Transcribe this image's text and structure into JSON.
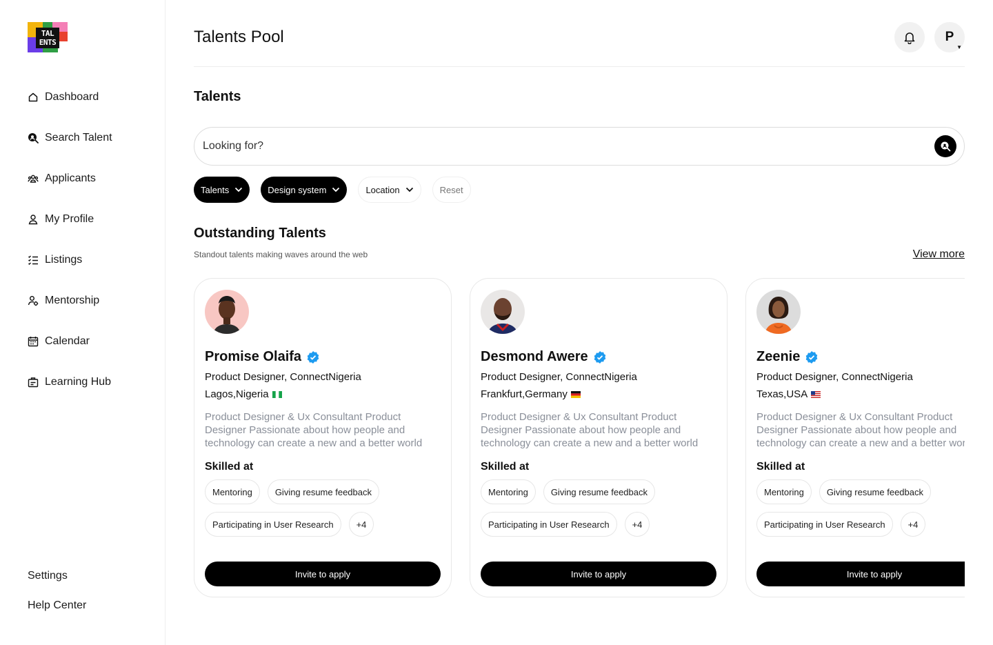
{
  "logo": {
    "text_line1": "TAL",
    "text_line2": "ENTS"
  },
  "sidebar": {
    "items": [
      {
        "label": "Dashboard",
        "icon": "home-icon"
      },
      {
        "label": "Search Talent",
        "icon": "search-talent-icon"
      },
      {
        "label": "Applicants",
        "icon": "applicants-icon"
      },
      {
        "label": "My Profile",
        "icon": "profile-icon"
      },
      {
        "label": "Listings",
        "icon": "listings-icon"
      },
      {
        "label": "Mentorship",
        "icon": "mentorship-icon"
      },
      {
        "label": "Calendar",
        "icon": "calendar-icon"
      },
      {
        "label": "Learning Hub",
        "icon": "learning-hub-icon"
      }
    ],
    "bottom": {
      "settings": "Settings",
      "help": "Help Center"
    }
  },
  "header": {
    "title": "Talents Pool",
    "avatar_initial": "P"
  },
  "main": {
    "section_title": "Talents",
    "search": {
      "placeholder": "Looking for?"
    },
    "filters": {
      "talents": "Talents",
      "design_system": "Design system",
      "location": "Location",
      "reset": "Reset"
    },
    "outstanding": {
      "title": "Outstanding Talents",
      "subtitle": "Standout talents making waves around the web",
      "view_more": "View more"
    }
  },
  "talents": [
    {
      "name": "Promise Olaifa",
      "role": "Product Designer, ConnectNigeria",
      "location": "Lagos,Nigeria",
      "bio": "Product Designer & Ux Consultant Product Designer Passionate about how people and technology can create a new and a better world",
      "skilled_label": "Skilled at",
      "skills": [
        "Mentoring",
        "Giving resume feedback",
        "Participating in User Research",
        "+4"
      ],
      "invite_label": "Invite to apply"
    },
    {
      "name": "Desmond Awere",
      "role": "Product Designer, ConnectNigeria",
      "location": "Frankfurt,Germany",
      "bio": "Product Designer & Ux Consultant Product Designer Passionate about how people and technology can create a new and a better world",
      "skilled_label": "Skilled at",
      "skills": [
        "Mentoring",
        "Giving resume feedback",
        "Participating in User Research",
        "+4"
      ],
      "invite_label": "Invite to apply"
    },
    {
      "name": "Zeenie",
      "role": "Product Designer, ConnectNigeria",
      "location": "Texas,USA",
      "bio": "Product Designer & Ux Consultant Product Designer Passionate about how people and technology can create a new and a better world",
      "skilled_label": "Skilled at",
      "skills": [
        "Mentoring",
        "Giving resume feedback",
        "Participating in User Research",
        "+4"
      ],
      "invite_label": "Invite to apply"
    }
  ],
  "colors": {
    "primary": "#000000",
    "verified": "#1d9bf0",
    "muted_text": "#8a8f99",
    "border": "#e8e8e8"
  }
}
